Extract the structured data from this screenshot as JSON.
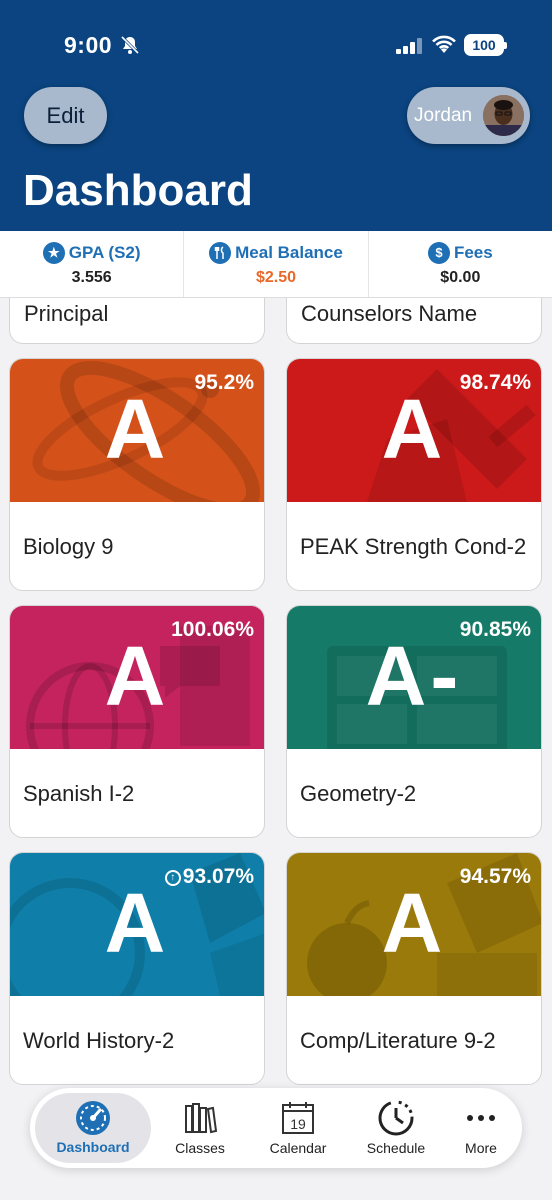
{
  "status_bar": {
    "time": "9:00",
    "battery": "100"
  },
  "header": {
    "edit_label": "Edit",
    "user_name": "Jordan",
    "title": "Dashboard"
  },
  "summary": [
    {
      "icon": "star-icon",
      "label": "GPA (S2)",
      "value": "3.556"
    },
    {
      "icon": "utensils-icon",
      "label": "Meal Balance",
      "value": "$2.50"
    },
    {
      "icon": "dollar-icon",
      "label": "Fees",
      "value": "$0.00"
    }
  ],
  "partial_cards": [
    "Principal",
    "Counselors Name"
  ],
  "classes": [
    {
      "name": "Biology 9",
      "grade": "A",
      "percent": "95.2%",
      "color": "#d4521a"
    },
    {
      "name": "PEAK Strength Cond-2",
      "grade": "A",
      "percent": "98.74%",
      "color": "#cc1a1a"
    },
    {
      "name": "Spanish I-2",
      "grade": "A",
      "percent": "100.06%",
      "color": "#c4235e"
    },
    {
      "name": "Geometry-2",
      "grade": "A-",
      "percent": "90.85%",
      "color": "#157a68"
    },
    {
      "name": "World History-2",
      "grade": "A",
      "percent": "93.07%",
      "color": "#0f7ea8",
      "trend": "up"
    },
    {
      "name": "Comp/Literature 9-2",
      "grade": "A",
      "percent": "94.57%",
      "color": "#9a7a0a"
    }
  ],
  "tabs": [
    {
      "label": "Dashboard",
      "icon": "speedometer-icon",
      "active": true
    },
    {
      "label": "Classes",
      "icon": "books-icon"
    },
    {
      "label": "Calendar",
      "icon": "calendar-icon",
      "day": "19"
    },
    {
      "label": "Schedule",
      "icon": "clock-history-icon"
    },
    {
      "label": "More",
      "icon": "more-icon"
    }
  ]
}
